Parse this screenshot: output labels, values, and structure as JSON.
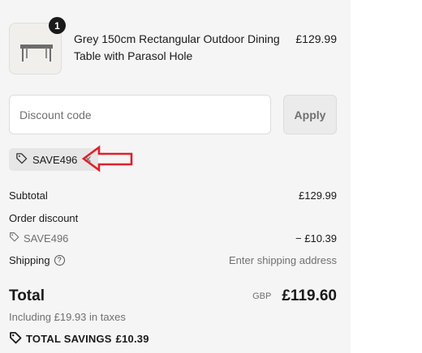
{
  "product": {
    "quantity": "1",
    "name": "Grey 150cm Rectangular Outdoor Dining Table with Parasol Hole",
    "price": "£129.99",
    "image_icon": "table-product-image"
  },
  "discount": {
    "placeholder": "Discount code",
    "apply_label": "Apply",
    "applied_code": "SAVE496",
    "remove_icon": "close-icon"
  },
  "summary": {
    "subtotal_label": "Subtotal",
    "subtotal_value": "£129.99",
    "order_discount_label": "Order discount",
    "discount_code": "SAVE496",
    "discount_value": "− £10.39",
    "shipping_label": "Shipping",
    "shipping_value": "Enter shipping address",
    "total_label": "Total",
    "currency": "GBP",
    "total_value": "£119.60",
    "taxes_note": "Including £19.93 in taxes",
    "savings_label": "TOTAL SAVINGS",
    "savings_value": "£10.39"
  },
  "colors": {
    "panel_bg": "#f5f5f5",
    "annotation_arrow": "#e0202a"
  }
}
